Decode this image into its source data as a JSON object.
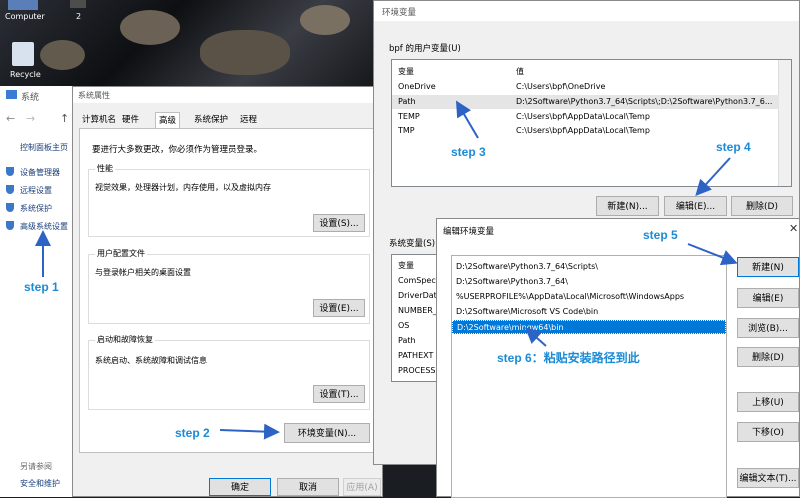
{
  "desktop": {
    "computer_label": "Computer",
    "recycle_label": "Recycle",
    "icon2_label": "2"
  },
  "system_window": {
    "title": "系统",
    "nav_home": "控制面板主页",
    "links": [
      "设备管理器",
      "远程设置",
      "系统保护",
      "高级系统设置"
    ],
    "see_also": "另请参阅",
    "security": "安全和维护"
  },
  "props_dialog": {
    "title": "系统属性",
    "tabs": [
      "计算机名",
      "硬件",
      "高级",
      "系统保护",
      "远程"
    ],
    "admin_note": "要进行大多数更改，你必须作为管理员登录。",
    "performance": {
      "label": "性能",
      "desc": "视觉效果，处理器计划，内存使用，以及虚拟内存",
      "button": "设置(S)..."
    },
    "profiles": {
      "label": "用户配置文件",
      "desc": "与登录帐户相关的桌面设置",
      "button": "设置(E)..."
    },
    "startup": {
      "label": "启动和故障恢复",
      "desc": "系统启动、系统故障和调试信息",
      "button": "设置(T)..."
    },
    "env_button": "环境变量(N)...",
    "ok": "确定",
    "cancel": "取消",
    "apply": "应用(A)"
  },
  "env_dialog": {
    "title": "环境变量",
    "user_section": "bpf 的用户变量(U)",
    "col_var": "变量",
    "col_val": "值",
    "user_vars": [
      {
        "name": "OneDrive",
        "value": "C:\\Users\\bpf\\OneDrive"
      },
      {
        "name": "Path",
        "value": "D:\\2Software\\Python3.7_64\\Scripts\\;D:\\2Software\\Python3.7_6..."
      },
      {
        "name": "TEMP",
        "value": "C:\\Users\\bpf\\AppData\\Local\\Temp"
      },
      {
        "name": "TMP",
        "value": "C:\\Users\\bpf\\AppData\\Local\\Temp"
      }
    ],
    "new_btn": "新建(N)...",
    "edit_btn": "编辑(E)...",
    "delete_btn": "删除(D)",
    "system_section": "系统变量(S)",
    "sys_col_var": "变量",
    "system_vars": [
      "ComSpec",
      "DriverData",
      "NUMBER_",
      "OS",
      "Path",
      "PATHEXT",
      "PROCESSO"
    ]
  },
  "edit_dialog": {
    "title": "编辑环境变量",
    "entries": [
      "D:\\2Software\\Python3.7_64\\Scripts\\",
      "D:\\2Software\\Python3.7_64\\",
      "%USERPROFILE%\\AppData\\Local\\Microsoft\\WindowsApps",
      "D:\\2Software\\Microsoft VS Code\\bin",
      "D:\\2Software\\mingw64\\bin"
    ],
    "buttons": {
      "new": "新建(N)",
      "edit": "编辑(E)",
      "browse": "浏览(B)...",
      "delete": "删除(D)",
      "up": "上移(U)",
      "down": "下移(O)",
      "edit_text": "编辑文本(T)..."
    }
  },
  "annotations": {
    "step1": "step 1",
    "step2": "step 2",
    "step3": "step 3",
    "step4": "step 4",
    "step5": "step 5",
    "step6": "step 6：粘贴安装路径到此"
  },
  "colors": {
    "accent": "#1b8bd6",
    "selection": "#0078d7",
    "arrow": "#2e63c6"
  }
}
